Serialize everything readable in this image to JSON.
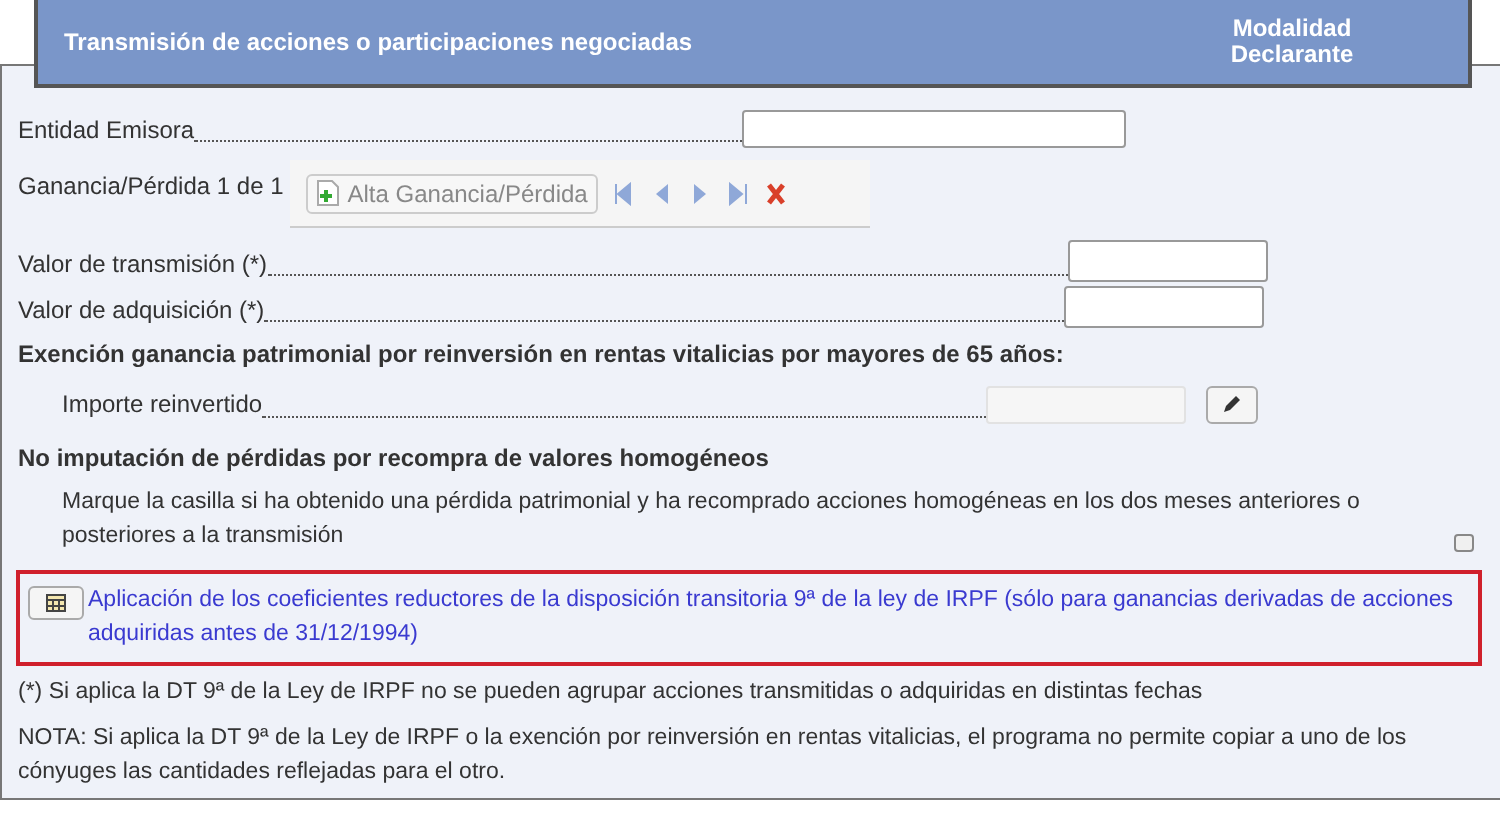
{
  "header": {
    "title": "Transmisión de acciones o participaciones negociadas",
    "column_label": "Modalidad Declarante"
  },
  "entidad": {
    "label": "Entidad Emisora"
  },
  "ganancia": {
    "counter": "Ganancia/Pérdida 1 de 1",
    "add_button": "Alta Ganancia/Pérdida",
    "nav": [
      {
        "kind": "first",
        "disabled": false
      },
      {
        "kind": "prev",
        "disabled": false
      },
      {
        "kind": "next",
        "disabled": false
      },
      {
        "kind": "last",
        "disabled": false
      },
      {
        "kind": "delete",
        "disabled": false
      }
    ]
  },
  "valores": [
    {
      "label": "Valor de transmisión (*)"
    },
    {
      "label": "Valor de adquisición (*)"
    }
  ],
  "exencion": {
    "heading": "Exención ganancia patrimonial por reinversión en rentas vitalicias por mayores de 65 años:",
    "label": "Importe reinvertido",
    "disabled": true
  },
  "no_imputacion": {
    "heading": "No imputación de pérdidas por recompra de valores homogéneos",
    "text": "Marque la casilla si ha obtenido una pérdida patrimonial y ha recomprado acciones homogéneas en los dos meses anteriores o posteriores a la transmisión",
    "checked": false
  },
  "coeficientes": {
    "link": "Aplicación de los coeficientes reductores de la disposición transitoria 9ª de la ley de IRPF (sólo para ganancias derivadas de acciones adquiridas antes de 31/12/1994)"
  },
  "notes": [
    "(*) Si aplica la DT 9ª de la Ley de IRPF no se pueden agrupar acciones transmitidas o adquiridas en distintas fechas",
    "NOTA: Si aplica la DT 9ª de la Ley de IRPF o la exención por reinversión en rentas vitalicias, el programa no permite copiar a uno de los cónyuges las cantidades reflejadas para el otro."
  ]
}
